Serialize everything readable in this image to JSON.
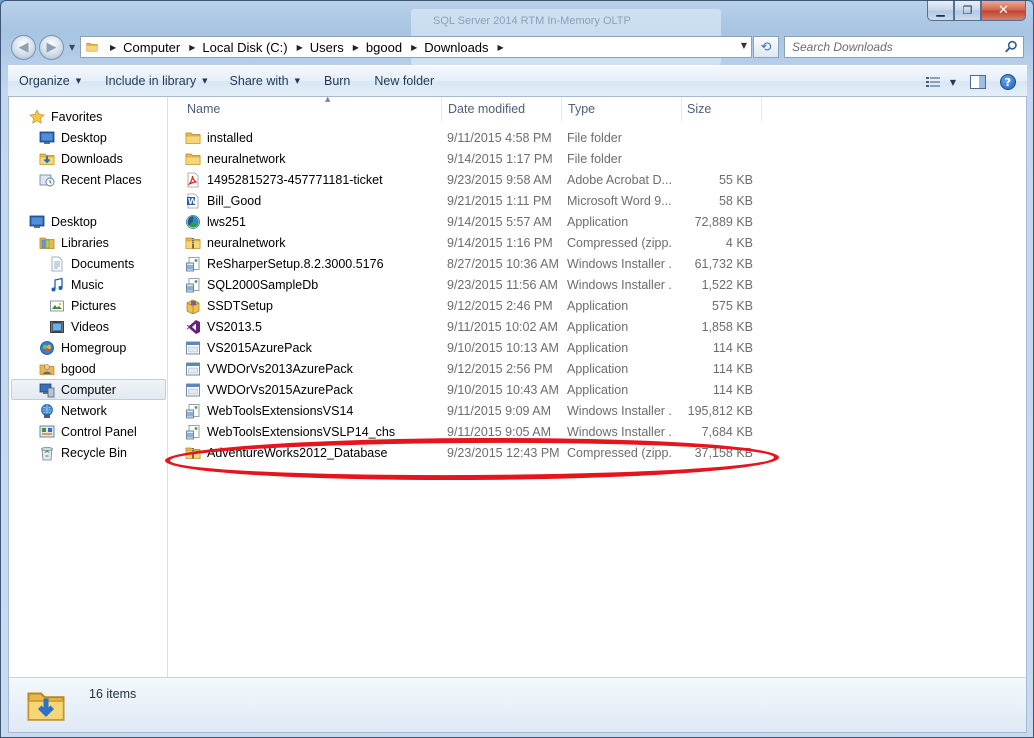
{
  "window": {
    "background_ghost_text": "SQL Server 2014 RTM In-Memory OLTP",
    "controls": {
      "minimize": "▁",
      "maximize": "❐",
      "close": "✕"
    }
  },
  "address": {
    "crumbs": [
      "Computer",
      "Local Disk (C:)",
      "Users",
      "bgood",
      "Downloads"
    ]
  },
  "search": {
    "placeholder": "Search Downloads"
  },
  "toolbar": {
    "organize": "Organize",
    "include_in_library": "Include in library",
    "share_with": "Share with",
    "burn": "Burn",
    "new_folder": "New folder",
    "help": "?"
  },
  "nav": {
    "favorites": "Favorites",
    "desktop_fav": "Desktop",
    "downloads": "Downloads",
    "recent_places": "Recent Places",
    "desktop": "Desktop",
    "libraries": "Libraries",
    "documents": "Documents",
    "music": "Music",
    "pictures": "Pictures",
    "videos": "Videos",
    "homegroup": "Homegroup",
    "bgood": "bgood",
    "computer": "Computer",
    "network": "Network",
    "control_panel": "Control Panel",
    "recycle_bin": "Recycle Bin"
  },
  "columns": {
    "name": "Name",
    "date": "Date modified",
    "type": "Type",
    "size": "Size"
  },
  "files": [
    {
      "name": "installed",
      "date": "9/11/2015 4:58 PM",
      "type": "File folder",
      "size": "",
      "icon": "folder"
    },
    {
      "name": "neuralnetwork",
      "date": "9/14/2015 1:17 PM",
      "type": "File folder",
      "size": "",
      "icon": "folder"
    },
    {
      "name": "14952815273-457771181-ticket",
      "date": "9/23/2015 9:58 AM",
      "type": "Adobe Acrobat D...",
      "size": "55 KB",
      "icon": "pdf"
    },
    {
      "name": "Bill_Good",
      "date": "9/21/2015 1:11 PM",
      "type": "Microsoft Word 9...",
      "size": "58 KB",
      "icon": "word"
    },
    {
      "name": "lws251",
      "date": "9/14/2015 5:57 AM",
      "type": "Application",
      "size": "72,889 KB",
      "icon": "app-color"
    },
    {
      "name": "neuralnetwork",
      "date": "9/14/2015 1:16 PM",
      "type": "Compressed (zipp...",
      "size": "4 KB",
      "icon": "zip"
    },
    {
      "name": "ReSharperSetup.8.2.3000.5176",
      "date": "8/27/2015 10:36 AM",
      "type": "Windows Installer ...",
      "size": "61,732 KB",
      "icon": "msi"
    },
    {
      "name": "SQL2000SampleDb",
      "date": "9/23/2015 11:56 AM",
      "type": "Windows Installer ...",
      "size": "1,522 KB",
      "icon": "msi"
    },
    {
      "name": "SSDTSetup",
      "date": "9/12/2015 2:46 PM",
      "type": "Application",
      "size": "575 KB",
      "icon": "setup"
    },
    {
      "name": "VS2013.5",
      "date": "9/11/2015 10:02 AM",
      "type": "Application",
      "size": "1,858 KB",
      "icon": "vs"
    },
    {
      "name": "VS2015AzurePack",
      "date": "9/10/2015 10:13 AM",
      "type": "Application",
      "size": "114 KB",
      "icon": "app"
    },
    {
      "name": "VWDOrVs2013AzurePack",
      "date": "9/12/2015 2:56 PM",
      "type": "Application",
      "size": "114 KB",
      "icon": "app"
    },
    {
      "name": "VWDOrVs2015AzurePack",
      "date": "9/10/2015 10:43 AM",
      "type": "Application",
      "size": "114 KB",
      "icon": "app"
    },
    {
      "name": "WebToolsExtensionsVS14",
      "date": "9/11/2015 9:09 AM",
      "type": "Windows Installer ...",
      "size": "195,812 KB",
      "icon": "msi"
    },
    {
      "name": "WebToolsExtensionsVSLP14_chs",
      "date": "9/11/2015 9:05 AM",
      "type": "Windows Installer ...",
      "size": "7,684 KB",
      "icon": "msi"
    },
    {
      "name": "AdventureWorks2012_Database",
      "date": "9/23/2015 12:43 PM",
      "type": "Compressed (zipp...",
      "size": "37,158 KB",
      "icon": "zip"
    }
  ],
  "status": {
    "count": "16 items"
  },
  "colors": {
    "highlight": "#e6141c",
    "folder": "#e8b84a",
    "accent": "#1e5eb4"
  }
}
